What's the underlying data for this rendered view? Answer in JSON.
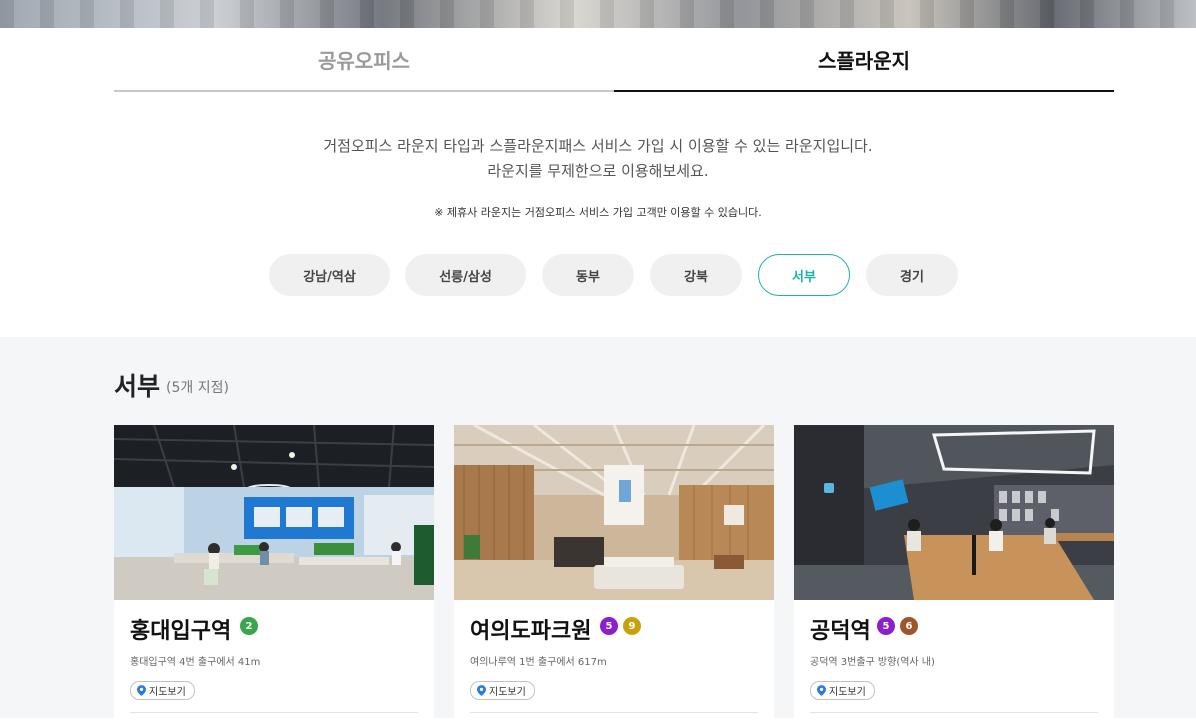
{
  "tabs": [
    {
      "label": "공유오피스",
      "active": false
    },
    {
      "label": "스플라운지",
      "active": true
    }
  ],
  "intro": {
    "line1": "거점오피스 라운지 타입과 스플라운지패스 서비스 가입 시 이용할 수 있는 라운지입니다.",
    "line2": "라운지를 무제한으로 이용해보세요.",
    "notice": "※ 제휴사 라운지는 거점오피스 서비스 가입 고객만 이용할 수 있습니다."
  },
  "regions": [
    {
      "label": "강남/역삼",
      "active": false
    },
    {
      "label": "선릉/삼성",
      "active": false
    },
    {
      "label": "동부",
      "active": false
    },
    {
      "label": "강북",
      "active": false
    },
    {
      "label": "서부",
      "active": true
    },
    {
      "label": "경기",
      "active": false
    }
  ],
  "accent_color": "#1fb3a5",
  "section": {
    "title": "서부",
    "count": "(5개 지점)"
  },
  "map_button_label": "지도보기",
  "cards": [
    {
      "name": "홍대입구역",
      "address": "홍대입구역 4번 출구에서 41m",
      "lines": [
        {
          "label": "2",
          "color": "#3aa54a"
        }
      ]
    },
    {
      "name": "여의도파크원",
      "address": "여의나루역 1번 출구에서 617m",
      "lines": [
        {
          "label": "5",
          "color": "#8b1fcc"
        },
        {
          "label": "9",
          "color": "#c9a10f"
        }
      ]
    },
    {
      "name": "공덕역",
      "address": "공덕역 3번출구 방향(역사 내)",
      "lines": [
        {
          "label": "5",
          "color": "#8b1fcc"
        },
        {
          "label": "6",
          "color": "#a0562a"
        }
      ]
    }
  ]
}
